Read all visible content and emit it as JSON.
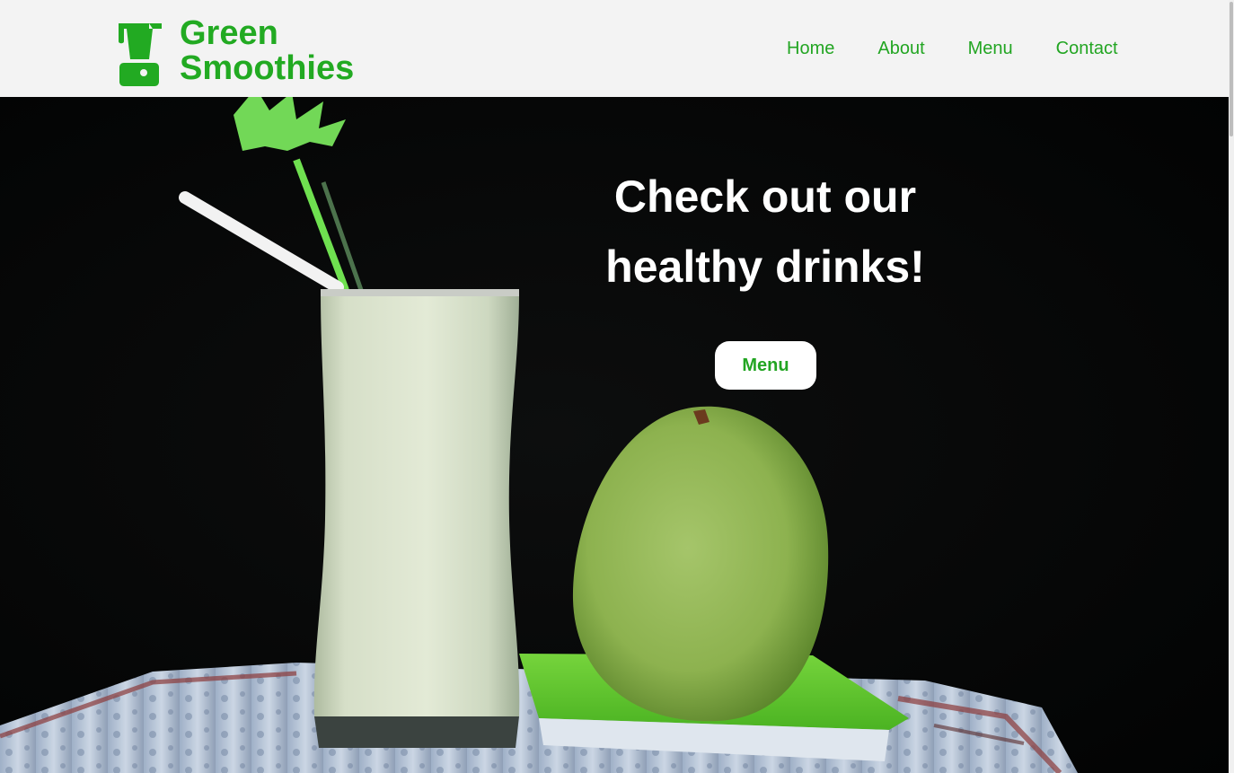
{
  "header": {
    "logo_line1": "Green",
    "logo_line2": "Smoothies",
    "logo_icon": "blender-icon",
    "nav": [
      "Home",
      "About",
      "Menu",
      "Contact"
    ]
  },
  "hero": {
    "title_line1": "Check out our",
    "title_line2": "healthy drinks!",
    "button_label": "Menu",
    "image": "smoothie-glass-and-guava-photo"
  },
  "colors": {
    "brand_green": "#22a522",
    "header_bg": "#f3f3f3",
    "hero_bg": "#040505",
    "button_bg": "#ffffff"
  }
}
